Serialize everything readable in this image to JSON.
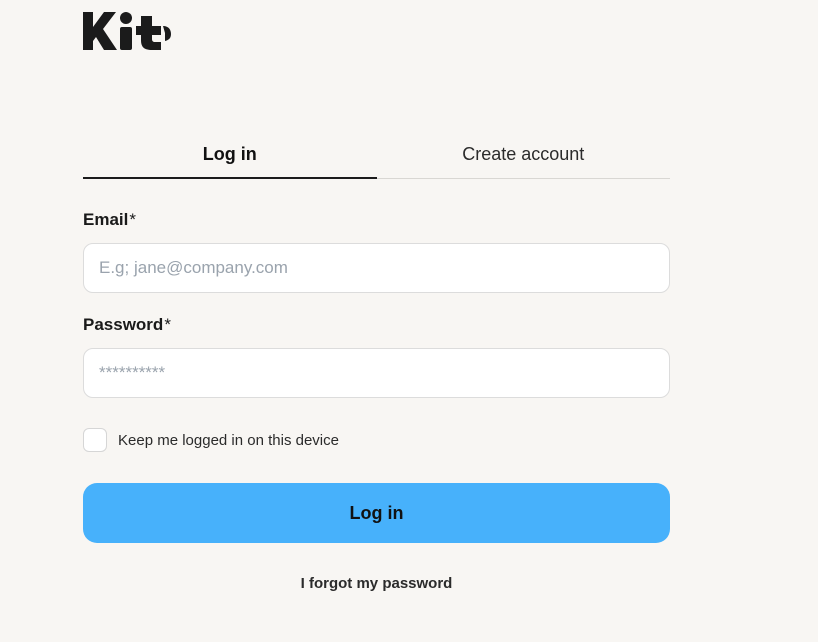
{
  "brand": {
    "logo_text": "Kit"
  },
  "tabs": [
    {
      "label": "Log in",
      "active": true
    },
    {
      "label": "Create account",
      "active": false
    }
  ],
  "email": {
    "label": "Email",
    "required_mark": "*",
    "placeholder": "E.g; jane@company.com",
    "value": ""
  },
  "password": {
    "label": "Password",
    "required_mark": "*",
    "placeholder": "**********",
    "value": ""
  },
  "remember": {
    "label": "Keep me logged in on this device",
    "checked": false
  },
  "actions": {
    "login_label": "Log in",
    "forgot_label": "I forgot my password"
  },
  "colors": {
    "background": "#f8f6f3",
    "primary_button": "#47b1fb",
    "text": "#1f1f1f"
  }
}
